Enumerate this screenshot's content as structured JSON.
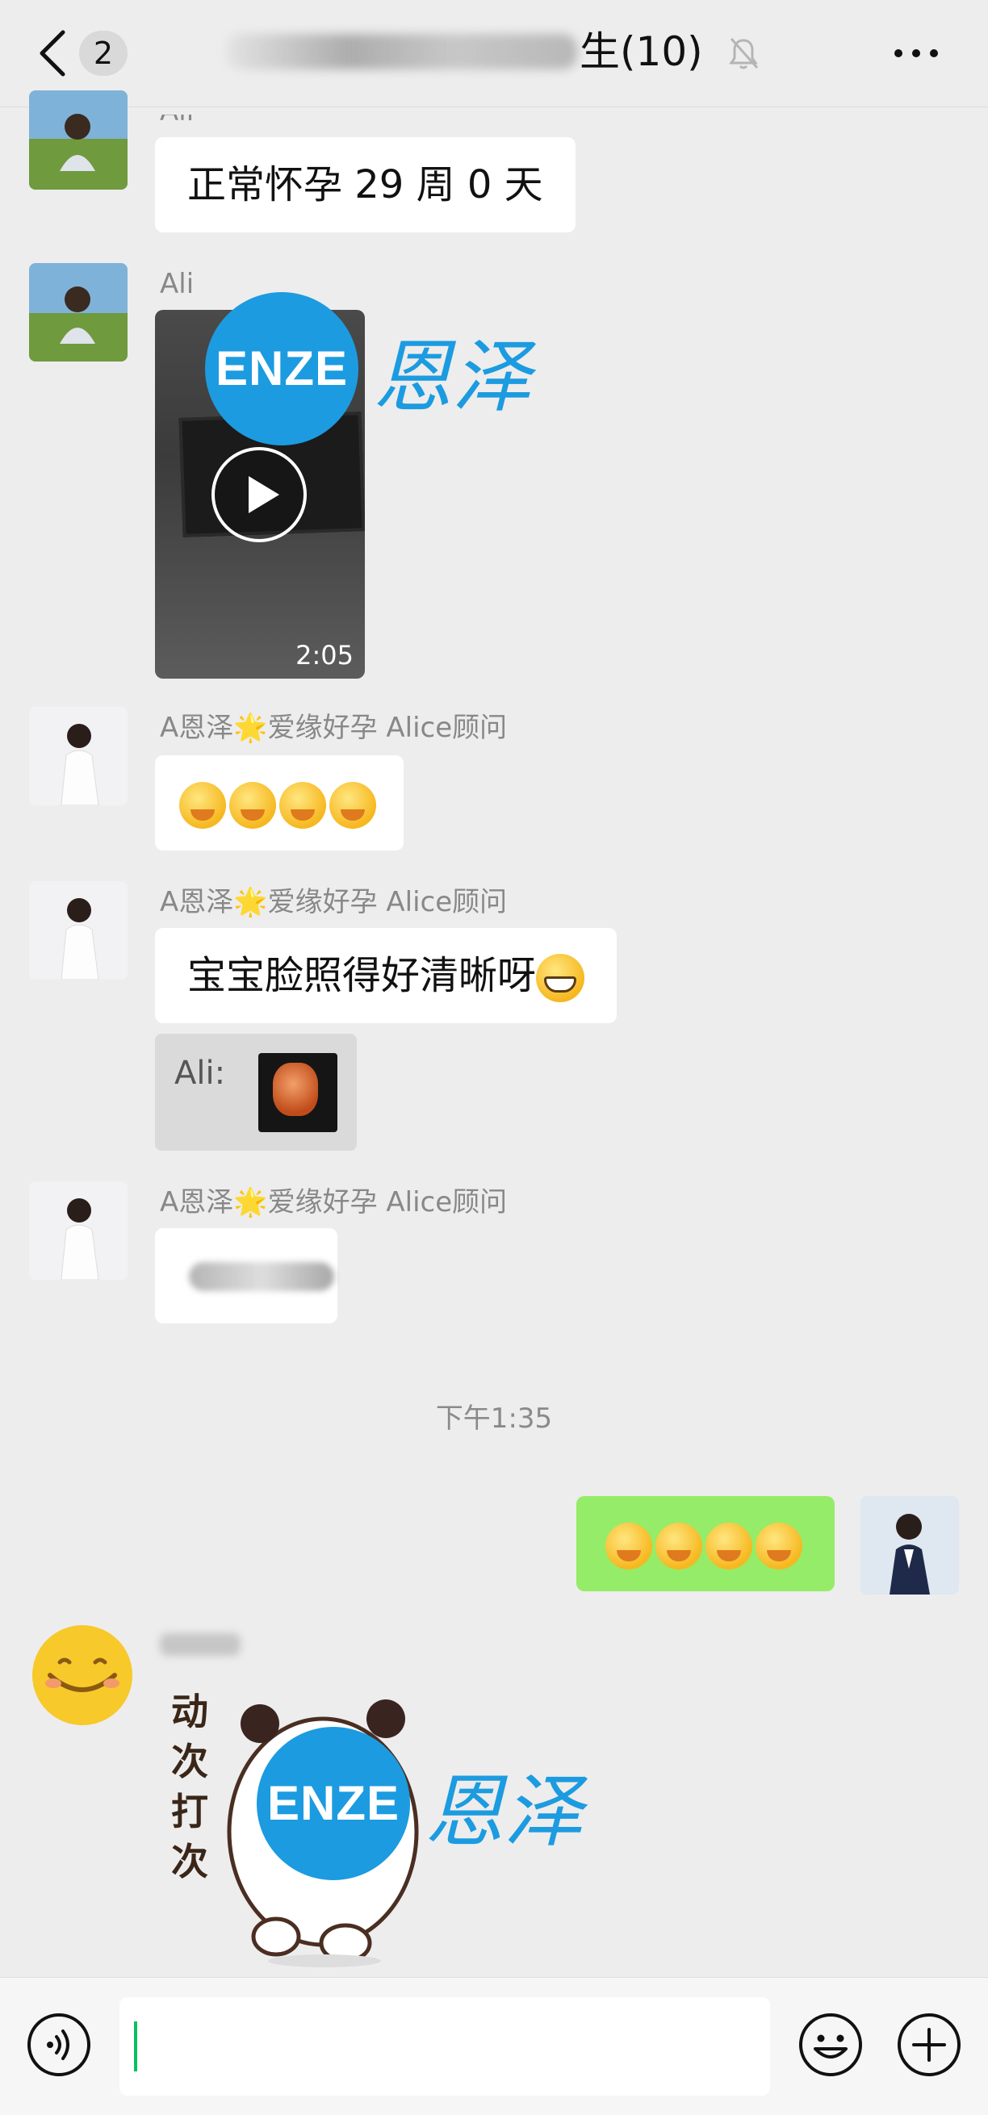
{
  "header": {
    "back_badge": "2",
    "title": "生(10)",
    "icons": [
      "back-chevron-icon",
      "mute-bell-icon",
      "more-icon"
    ]
  },
  "messages": [
    {
      "sender": "Ali",
      "text": "正常怀孕 29 周 0 天"
    },
    {
      "sender": "Ali",
      "video_duration": "2:05",
      "watermark_logo": "ENZE",
      "watermark_text": "恩泽"
    },
    {
      "sender": "A恩泽🌟爱缘好孕 Alice顾问",
      "emoji_count": 4
    },
    {
      "sender": "A恩泽🌟爱缘好孕 Alice顾问",
      "text": "宝宝脸照得好清晰呀",
      "quote_label": "Ali:"
    },
    {
      "sender": "A恩泽🌟爱缘好孕 Alice顾问",
      "text": ""
    }
  ],
  "timestamp": "下午1:35",
  "self_message": {
    "emoji_count": 4
  },
  "sticker_message": {
    "sticker_text": "动次打次",
    "watermark_logo": "ENZE",
    "watermark_text": "恩泽"
  },
  "colors": {
    "background": "#ededed",
    "self_bubble": "#95ec69",
    "accent": "#07c160",
    "watermark": "#1c9be0"
  }
}
